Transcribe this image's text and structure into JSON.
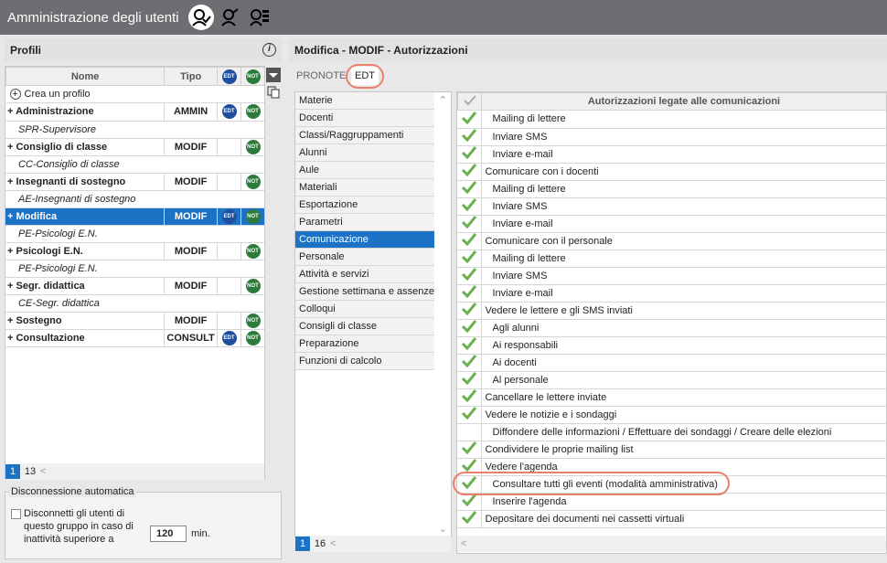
{
  "app": {
    "title": "Amministrazione degli utenti"
  },
  "profili": {
    "title": "Profili",
    "col_nome": "Nome",
    "col_tipo": "Tipo",
    "edt": "EDT",
    "not": "NOT",
    "create": "Crea un profilo",
    "rows": [
      {
        "name": "Administrazione",
        "tipo": "AMMIN",
        "edt": true,
        "not": true,
        "sub": "SPR-Supervisore"
      },
      {
        "name": "Consiglio di classe",
        "tipo": "MODIF",
        "edt": false,
        "not": true,
        "sub": "CC-Consiglio di classe"
      },
      {
        "name": "Insegnanti di sostegno",
        "tipo": "MODIF",
        "edt": false,
        "not": true,
        "sub": "AE-Insegnanti di sostegno"
      },
      {
        "name": "Modifica",
        "tipo": "MODIF",
        "edt": true,
        "not": true,
        "sub": "PE-Psicologi E.N.",
        "selected": true
      },
      {
        "name": "Psicologi E.N.",
        "tipo": "MODIF",
        "edt": false,
        "not": true,
        "sub": "PE-Psicologi E.N."
      },
      {
        "name": "Segr. didattica",
        "tipo": "MODIF",
        "edt": false,
        "not": true,
        "sub": "CE-Segr. didattica"
      },
      {
        "name": "Sostegno",
        "tipo": "MODIF",
        "edt": false,
        "not": true
      },
      {
        "name": "Consultazione",
        "tipo": "CONSULT",
        "edt": true,
        "not": true
      }
    ],
    "pager_current": "1",
    "pager_total": "13"
  },
  "disconnect": {
    "legend": "Disconnessione automatica",
    "text": "Disconnetti gli utenti di questo gruppo in caso di inattività superiore a",
    "value": "120",
    "unit": "min."
  },
  "main": {
    "title": "Modifica - MODIF - Autorizzazioni",
    "tabs": [
      "PRONOTE",
      "EDT"
    ],
    "categories": [
      "Materie",
      "Docenti",
      "Classi/Raggruppamenti",
      "Alunni",
      "Aule",
      "Materiali",
      "Esportazione",
      "Parametri",
      "Comunicazione",
      "Personale",
      "Attività e servizi",
      "Gestione settimana e assenze",
      "Colloqui",
      "Consigli di classe",
      "Preparazione",
      "Funzioni di calcolo"
    ],
    "selected_category": 8,
    "cat_pager_current": "1",
    "cat_pager_total": "16",
    "perm_header": "Autorizzazioni legate alle comunicazioni",
    "perms": [
      {
        "label": "Mailing di lettere",
        "indent": true,
        "checked": true
      },
      {
        "label": "Inviare SMS",
        "indent": true,
        "checked": true
      },
      {
        "label": "Inviare e-mail",
        "indent": true,
        "checked": true
      },
      {
        "label": "Comunicare con i docenti",
        "indent": false,
        "checked": true
      },
      {
        "label": "Mailing di lettere",
        "indent": true,
        "checked": true
      },
      {
        "label": "Inviare SMS",
        "indent": true,
        "checked": true
      },
      {
        "label": "Inviare e-mail",
        "indent": true,
        "checked": true
      },
      {
        "label": "Comunicare con il personale",
        "indent": false,
        "checked": true
      },
      {
        "label": "Mailing di lettere",
        "indent": true,
        "checked": true
      },
      {
        "label": "Inviare SMS",
        "indent": true,
        "checked": true
      },
      {
        "label": "Inviare e-mail",
        "indent": true,
        "checked": true
      },
      {
        "label": "Vedere le lettere e gli SMS inviati",
        "indent": false,
        "checked": true
      },
      {
        "label": "Agli alunni",
        "indent": true,
        "checked": true
      },
      {
        "label": "Ai responsabili",
        "indent": true,
        "checked": true
      },
      {
        "label": "Ai docenti",
        "indent": true,
        "checked": true
      },
      {
        "label": "Al personale",
        "indent": true,
        "checked": true
      },
      {
        "label": "Cancellare le lettere inviate",
        "indent": false,
        "checked": true
      },
      {
        "label": "Vedere le notizie e i sondaggi",
        "indent": false,
        "checked": true
      },
      {
        "label": "Diffondere delle informazioni / Effettuare dei sondaggi / Creare delle elezioni",
        "indent": true,
        "checked": false
      },
      {
        "label": "Condividere le proprie mailing list",
        "indent": false,
        "checked": true
      },
      {
        "label": "Vedere l'agenda",
        "indent": false,
        "checked": true
      },
      {
        "label": "Consultare tutti gli eventi (modalità amministrativa)",
        "indent": true,
        "checked": true
      },
      {
        "label": "Inserire l'agenda",
        "indent": true,
        "checked": true
      },
      {
        "label": "Depositare dei documenti nei cassetti virtuali",
        "indent": false,
        "checked": true
      }
    ]
  }
}
